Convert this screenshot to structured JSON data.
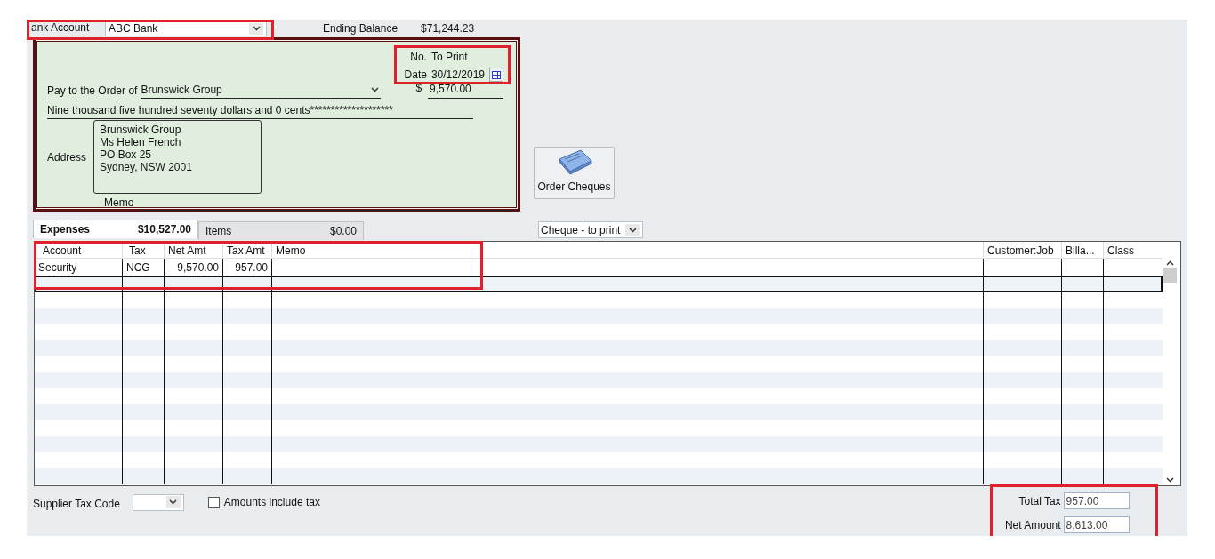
{
  "bank_account": {
    "label": "ank Account",
    "value": "ABC Bank"
  },
  "ending_balance": {
    "label": "Ending Balance",
    "value": "$71,244.23"
  },
  "cheque": {
    "no_label": "No.",
    "no_value": "To Print",
    "date_label": "Date",
    "date_value": "30/12/2019",
    "pay_to_label": "Pay to the Order of",
    "payee": "Brunswick Group",
    "currency": "$",
    "amount": "9,570.00",
    "amount_words": "Nine thousand five hundred seventy dollars and 0 cents********************",
    "address_label": "Address",
    "address_lines": [
      "Brunswick Group",
      "Ms Helen French",
      "PO Box 25",
      "Sydney, NSW 2001"
    ],
    "memo_label": "Memo"
  },
  "order_cheques_button": "Order Cheques",
  "tabs": [
    {
      "label": "Expenses",
      "amount": "$10,527.00",
      "selected": true
    },
    {
      "label": "Items",
      "amount": "$0.00",
      "selected": false
    }
  ],
  "print_status": "Cheque - to print",
  "table": {
    "columns": [
      "Account",
      "Tax",
      "Net Amt",
      "Tax Amt",
      "Memo",
      "Customer:Job",
      "Billa...",
      "Class"
    ],
    "rows": [
      {
        "account": "Security",
        "tax": "NCG",
        "net_amt": "9,570.00",
        "tax_amt": "957.00"
      }
    ]
  },
  "supplier_tax_code": {
    "label": "Supplier Tax Code"
  },
  "amounts_include_tax": {
    "label": "Amounts include tax",
    "checked": false
  },
  "totals": [
    {
      "label": "Total Tax",
      "value": "957.00"
    },
    {
      "label": "Net Amount",
      "value": "8,613.00"
    }
  ]
}
